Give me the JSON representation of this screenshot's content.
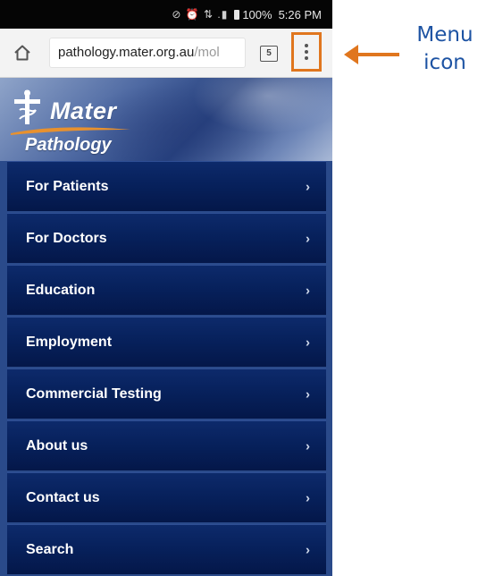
{
  "status_bar": {
    "icons": "⊘ ⏰ ⇅ .▮",
    "battery": "100%",
    "time": "5:26 PM"
  },
  "browser": {
    "url_domain": "pathology.mater.org.au",
    "url_path": "/mol",
    "tab_count": "5"
  },
  "logo": {
    "line1": "Mater",
    "line2": "Pathology"
  },
  "nav": {
    "items": [
      {
        "label": "For Patients"
      },
      {
        "label": "For Doctors"
      },
      {
        "label": "Education"
      },
      {
        "label": "Employment"
      },
      {
        "label": "Commercial Testing"
      },
      {
        "label": "About us"
      },
      {
        "label": "Contact us"
      },
      {
        "label": "Search"
      }
    ],
    "chevron": "›"
  },
  "annotation": {
    "label": "Menu icon",
    "color": "#e0761e",
    "text_color": "#1d53a3"
  }
}
